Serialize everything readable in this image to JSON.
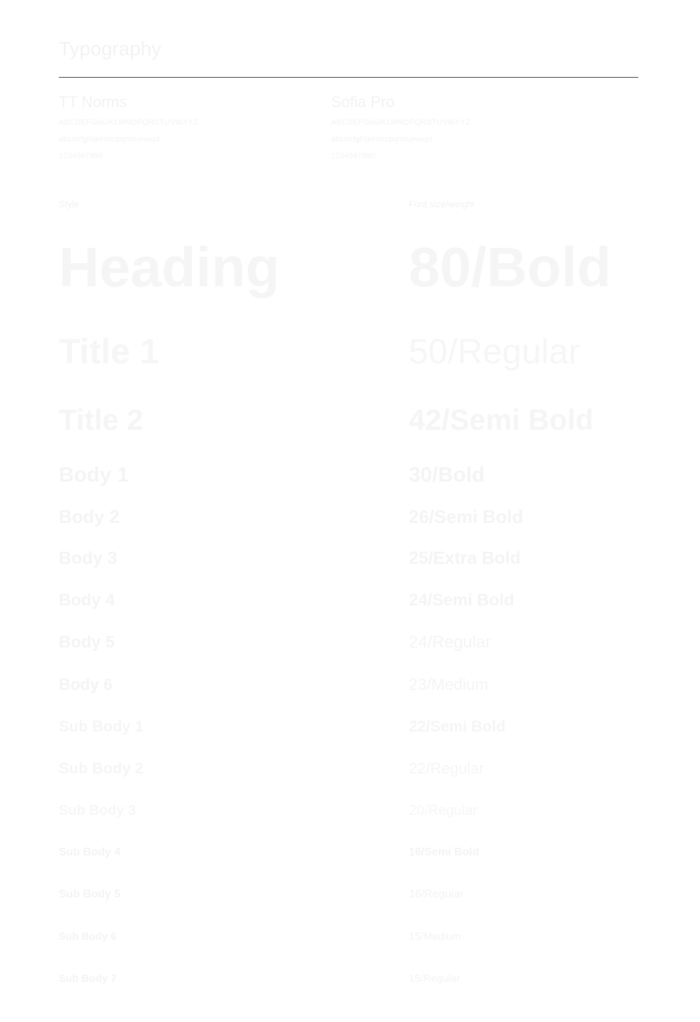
{
  "page": {
    "title": "Typography",
    "background_color": "#ffffff",
    "text_color": "#f4f4f4",
    "divider_color": "#3a3a3a"
  },
  "fonts": [
    {
      "name": "TT Norms",
      "uppercase": "ABCDEFGHIJKLMNOPQRSTUVWXYZ",
      "lowercase": "abcdefghijklmnopqrstuvwxyz",
      "digits": "1234567890"
    },
    {
      "name": "Sofia Pro",
      "uppercase": "ABCDEFGHIJKLMNOPQRSTUVWXYZ",
      "lowercase": "abcdefghijklmnopqrstuvwxyz",
      "digits": "1234567890"
    }
  ],
  "table": {
    "headers": {
      "style": "Style",
      "spec": "Font size/weight"
    },
    "rows": [
      {
        "style": "Heading",
        "spec": "80/Bold"
      },
      {
        "style": "Title 1",
        "spec": "50/Regular"
      },
      {
        "style": "Title 2",
        "spec": "42/Semi Bold"
      },
      {
        "style": "Body 1",
        "spec": "30/Bold"
      },
      {
        "style": "Body 2",
        "spec": "26/Semi Bold"
      },
      {
        "style": "Body 3",
        "spec": "25/Extra Bold"
      },
      {
        "style": "Body 4",
        "spec": "24/Semi Bold"
      },
      {
        "style": "Body 5",
        "spec": "24/Regular"
      },
      {
        "style": "Body 6",
        "spec": "23/Medium"
      },
      {
        "style": "Sub Body 1",
        "spec": "22/Semi Bold"
      },
      {
        "style": "Sub Body 2",
        "spec": "22/Regular"
      },
      {
        "style": "Sub Body 3",
        "spec": "20/Regular"
      },
      {
        "style": "Sub Body 4",
        "spec": "16/Semi Bold"
      },
      {
        "style": "Sub Body 5",
        "spec": "16/Regular"
      },
      {
        "style": "Sub Body 6",
        "spec": "15/Medium"
      },
      {
        "style": "Sub Body 7",
        "spec": "15/Regular"
      }
    ]
  }
}
